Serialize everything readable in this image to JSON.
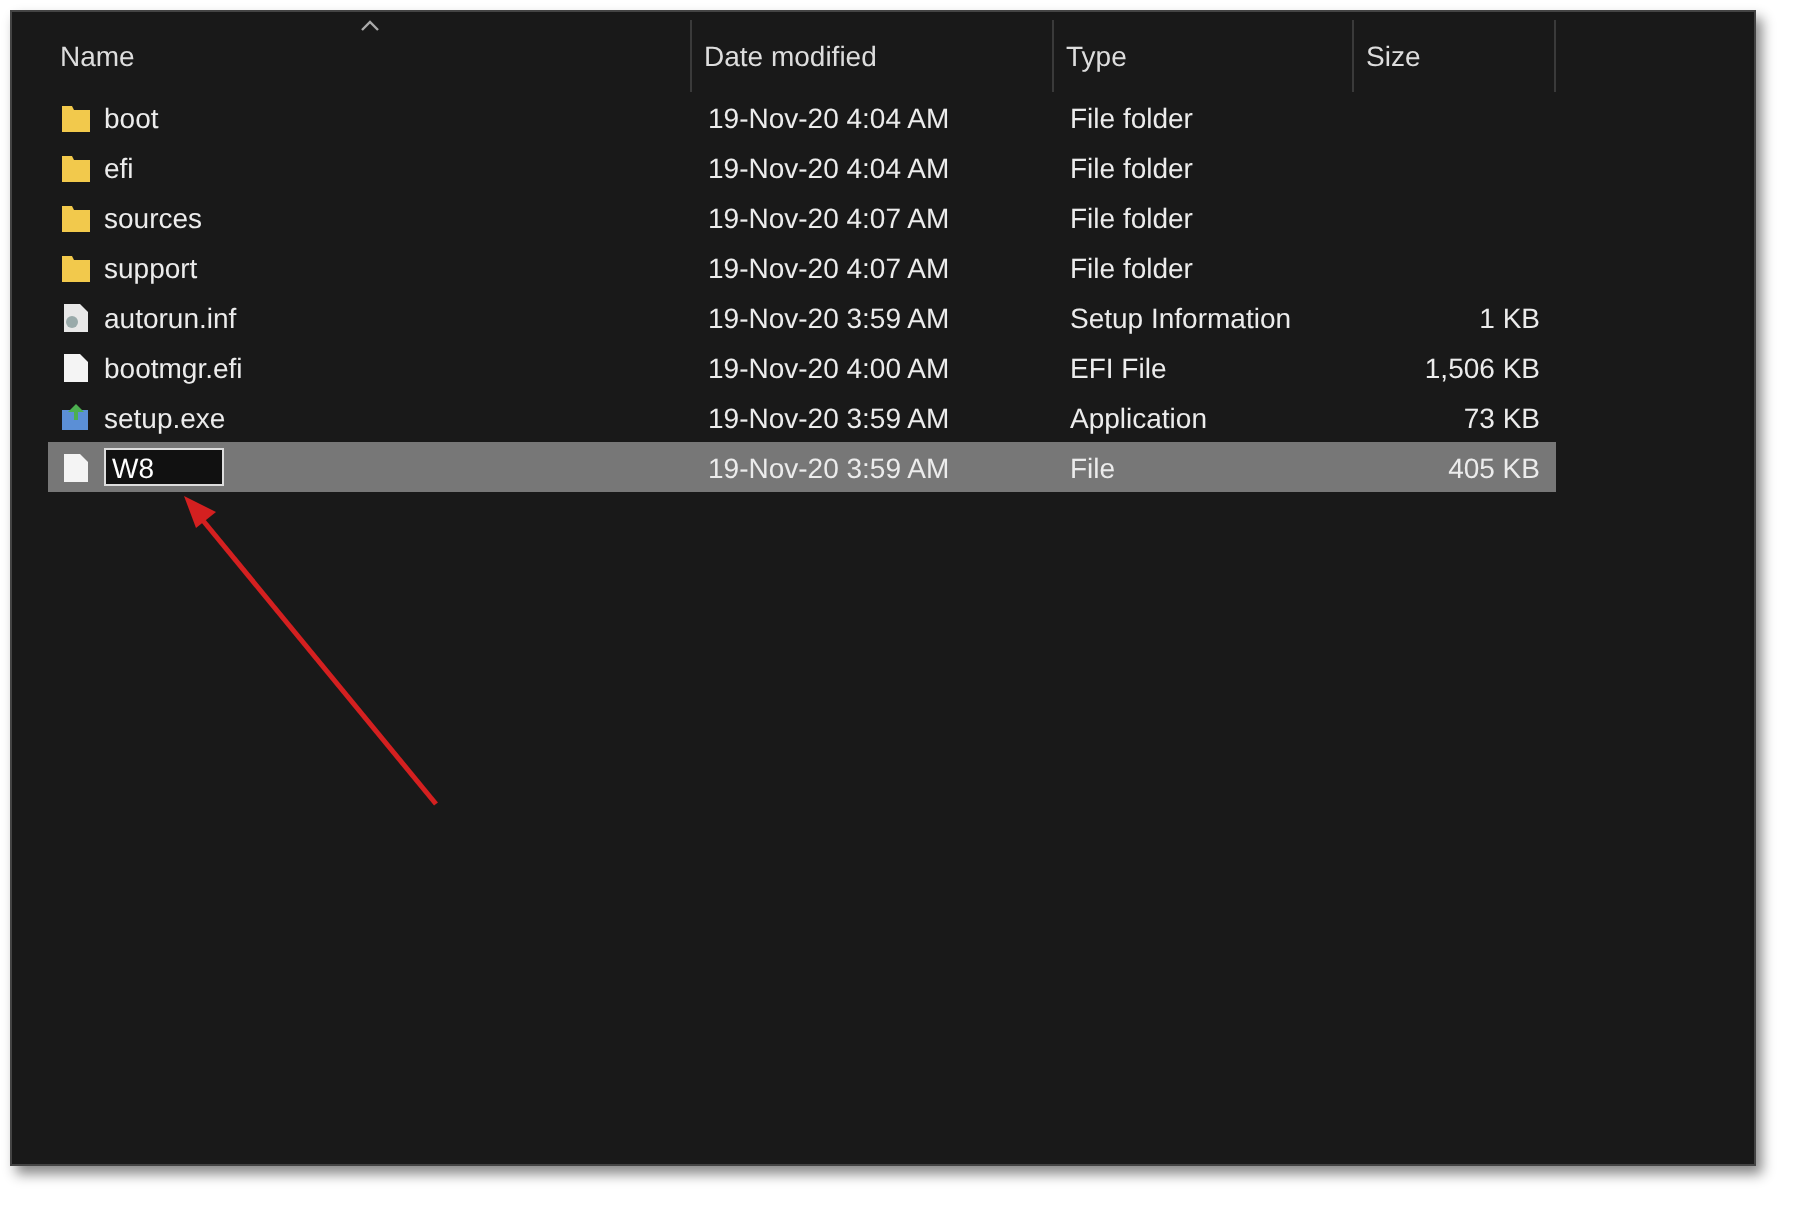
{
  "columns": [
    {
      "label": "Name",
      "sorted": true
    },
    {
      "label": "Date modified",
      "sorted": false
    },
    {
      "label": "Type",
      "sorted": false
    },
    {
      "label": "Size",
      "sorted": false
    }
  ],
  "rows": [
    {
      "kind": "folder",
      "name": "boot",
      "date": "19-Nov-20 4:04 AM",
      "type": "File folder",
      "selected": false,
      "editing": false
    },
    {
      "kind": "folder",
      "name": "efi",
      "date": "19-Nov-20 4:04 AM",
      "type": "File folder",
      "selected": false,
      "editing": false
    },
    {
      "kind": "folder",
      "name": "sources",
      "date": "19-Nov-20 4:07 AM",
      "type": "File folder",
      "selected": false,
      "editing": false
    },
    {
      "kind": "folder",
      "name": "support",
      "date": "19-Nov-20 4:07 AM",
      "type": "File folder",
      "selected": false,
      "editing": false
    },
    {
      "kind": "settings",
      "name": "autorun.inf",
      "date": "19-Nov-20 3:59 AM",
      "type": "Setup Information",
      "size": "1 KB",
      "selected": false,
      "editing": false
    },
    {
      "kind": "file",
      "name": "bootmgr.efi",
      "date": "19-Nov-20 4:00 AM",
      "type": "EFI File",
      "size": "1,506 KB",
      "selected": false,
      "editing": false
    },
    {
      "kind": "app",
      "name": "setup.exe",
      "date": "19-Nov-20 3:59 AM",
      "type": "Application",
      "size": "73 KB",
      "selected": false,
      "editing": false
    },
    {
      "kind": "file",
      "name": "W8",
      "date": "19-Nov-20 3:59 AM",
      "type": "File",
      "size": "405 KB",
      "selected": true,
      "editing": true
    }
  ]
}
